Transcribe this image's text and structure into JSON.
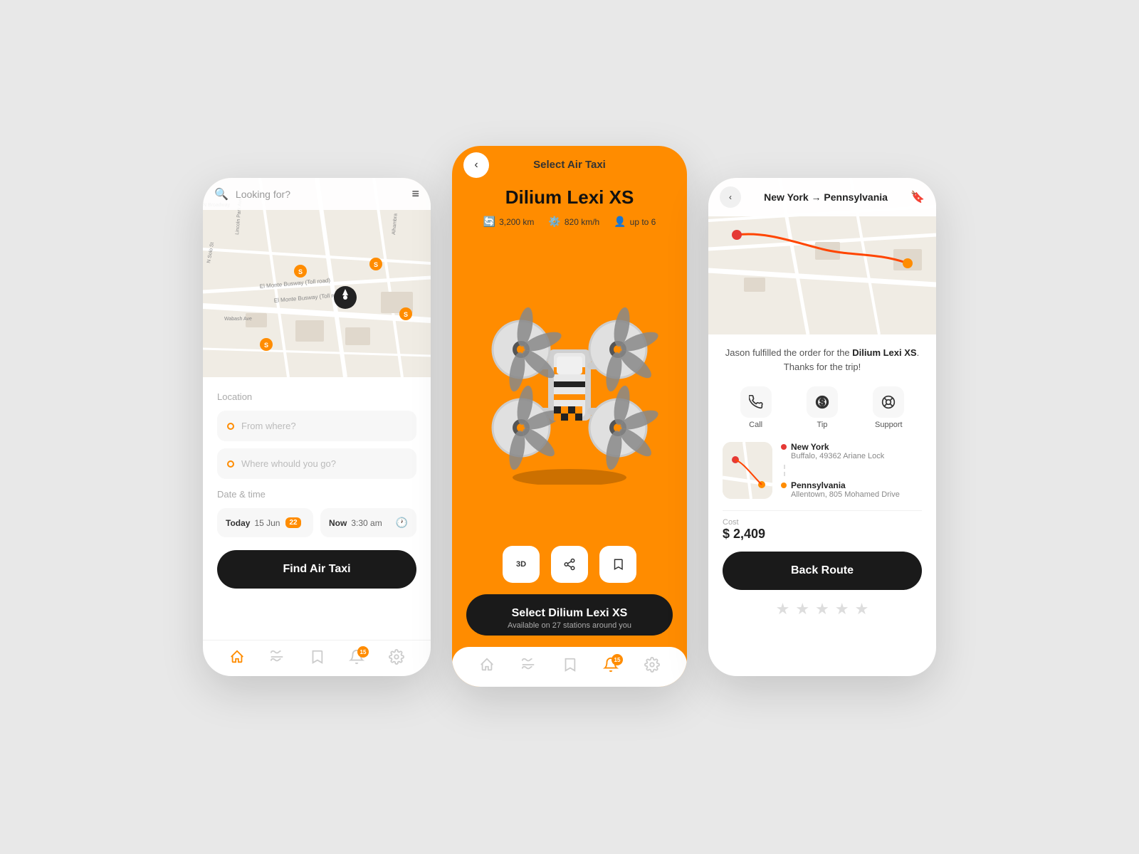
{
  "colors": {
    "orange": "#FF8C00",
    "dark": "#1a1a1a",
    "light_bg": "#f7f7f7",
    "map_bg": "#f0ece4"
  },
  "phone1": {
    "map": {
      "search_placeholder": "Looking for?"
    },
    "location_label": "Location",
    "from_placeholder": "From where?",
    "to_placeholder": "Where whould you go?",
    "datetime_label": "Date & time",
    "date_label": "Today",
    "date_value": "15 Jun",
    "time_label": "Now",
    "time_value": "3:30 am",
    "find_btn": "Find Air Taxi",
    "nav": {
      "home_badge": "15"
    }
  },
  "phone2": {
    "title": "Select Air Taxi",
    "taxi_name": "Dilium Lexi XS",
    "specs": {
      "range": "3,200 km",
      "speed": "820 km/h",
      "capacity": "up to 6"
    },
    "select_btn": "Select Dilium Lexi XS",
    "select_sub": "Available on 27 stations around you",
    "nav_badge": "15"
  },
  "phone3": {
    "route_title": "New York → Pennsylvania",
    "completion_msg_prefix": "Jason fulfilled the order for the ",
    "taxi_name_inline": "Dilium Lexi XS",
    "completion_msg_suffix": ". Thanks for the trip!",
    "actions": {
      "call": "Call",
      "tip": "Tip",
      "support": "Support"
    },
    "stop1": {
      "city": "New York",
      "address": "Buffalo, 49362 Ariane Lock"
    },
    "stop2": {
      "city": "Pennsylvania",
      "address": "Allentown, 805 Mohamed Drive"
    },
    "cost_label": "Cost",
    "cost_value": "$ 2,409",
    "back_route_btn": "Back Route"
  }
}
